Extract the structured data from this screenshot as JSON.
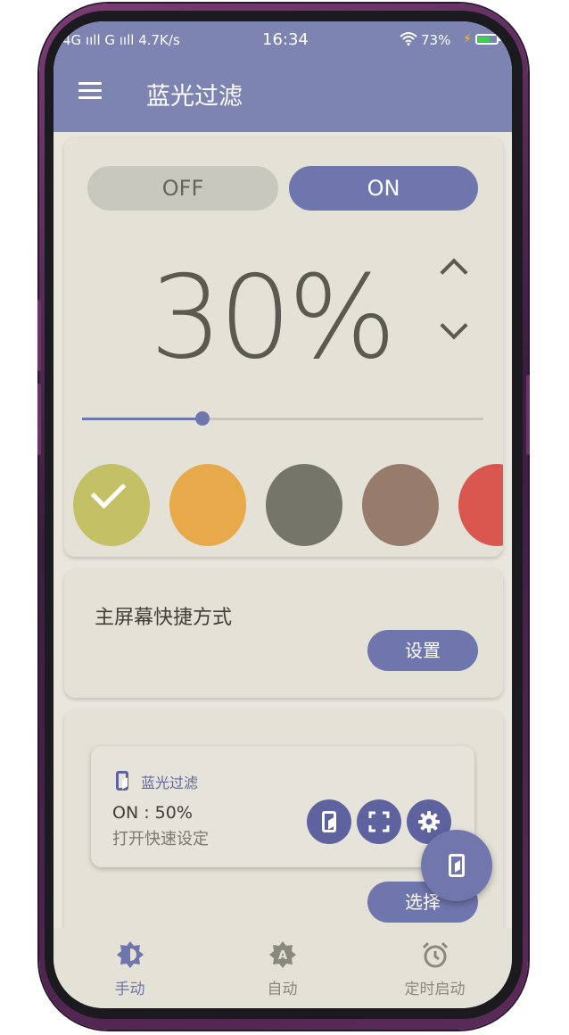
{
  "status_bar": {
    "network": "4G ııll G ııll 4.7K/s",
    "time": "16:34",
    "battery": "73%",
    "battery_level": 0.73
  },
  "app_bar": {
    "title": "蓝光过滤",
    "menu_icon": "hamburger-menu-icon"
  },
  "filter_card": {
    "off_label": "OFF",
    "on_label": "ON",
    "selected": "ON",
    "intensity": "30%",
    "slider_value": 0.3,
    "increase_icon": "chevron-up-icon",
    "decrease_icon": "chevron-down-icon",
    "colors": [
      "#c4c065",
      "#e8a94a",
      "#76756a",
      "#977c6b",
      "#d9574f"
    ],
    "selected_color_index": 0
  },
  "shortcut_card": {
    "title": "主屏幕快捷方式",
    "button": "设置"
  },
  "widget_card": {
    "preview_title": "蓝光过滤",
    "status": "ON : 50%",
    "quick_settings": "打开快速设定",
    "button": "选择",
    "icons": [
      "filter-phone-icon",
      "fullscreen-icon",
      "settings-gear-icon"
    ]
  },
  "fab": {
    "icon": "filter-phone-icon"
  },
  "bottom_nav": {
    "items": [
      {
        "label": "手动",
        "icon": "brightness-icon",
        "active": true
      },
      {
        "label": "自动",
        "icon": "auto-icon",
        "active": false
      },
      {
        "label": "定时启动",
        "icon": "alarm-clock-icon",
        "active": false
      }
    ],
    "active_color": "#6f75ad",
    "inactive_color": "#8a897f"
  },
  "colors": {
    "primary": "#7d84b2",
    "accent": "#6f75ad",
    "background": "#e9e7dd"
  }
}
